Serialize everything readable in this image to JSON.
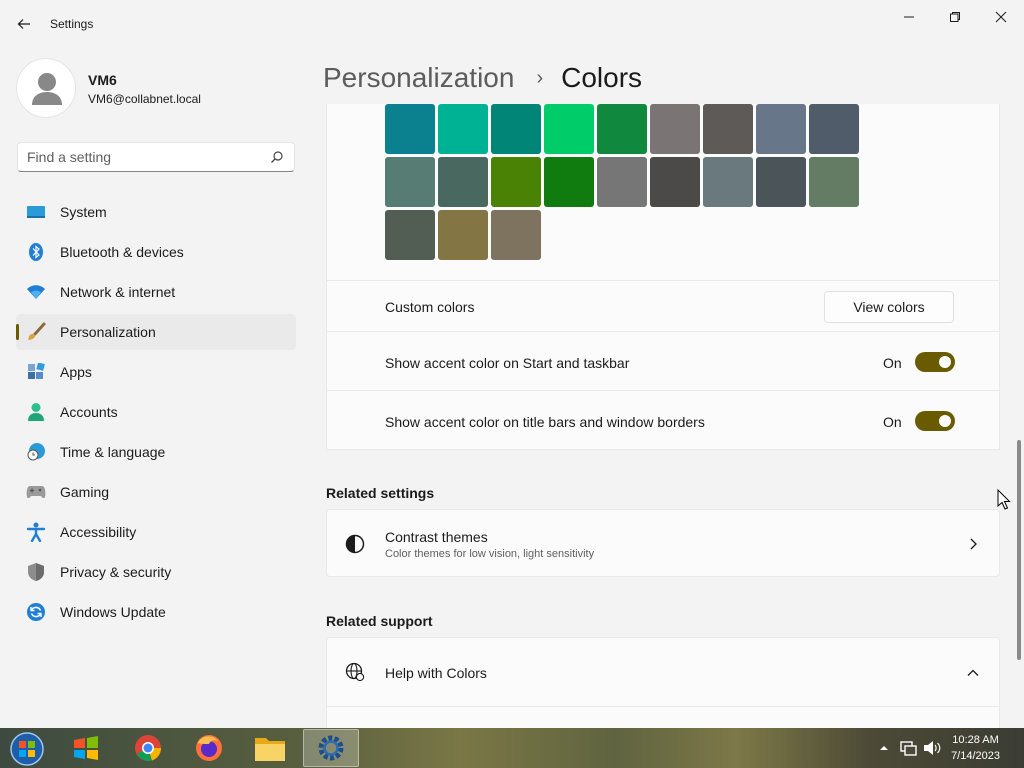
{
  "window": {
    "title": "Settings"
  },
  "profile": {
    "name": "VM6",
    "email": "VM6@collabnet.local"
  },
  "search": {
    "placeholder": "Find a setting"
  },
  "nav": [
    {
      "label": "System",
      "icon": "monitor-icon"
    },
    {
      "label": "Bluetooth & devices",
      "icon": "bluetooth-icon"
    },
    {
      "label": "Network & internet",
      "icon": "wifi-icon"
    },
    {
      "label": "Personalization",
      "icon": "brush-icon",
      "active": true
    },
    {
      "label": "Apps",
      "icon": "apps-icon"
    },
    {
      "label": "Accounts",
      "icon": "person-icon"
    },
    {
      "label": "Time & language",
      "icon": "globe-clock-icon"
    },
    {
      "label": "Gaming",
      "icon": "gamepad-icon"
    },
    {
      "label": "Accessibility",
      "icon": "accessibility-icon"
    },
    {
      "label": "Privacy & security",
      "icon": "shield-icon"
    },
    {
      "label": "Windows Update",
      "icon": "update-icon"
    }
  ],
  "breadcrumb": {
    "parent": "Personalization",
    "separator": "›",
    "current": "Colors"
  },
  "swatches": [
    [
      "#0b8190",
      "#00b294",
      "#008577",
      "#00cc6a",
      "#10893e",
      "#7a7574",
      "#5d5a58",
      "#68768a",
      "#515c6b"
    ],
    [
      "#567c73",
      "#486860",
      "#498205",
      "#107c10",
      "#767676",
      "#4c4a48",
      "#69797e",
      "#4a5459",
      "#647c64"
    ],
    [
      "#525e54",
      "#847545",
      "#7e735f"
    ]
  ],
  "custom_colors": {
    "label": "Custom colors",
    "button": "View colors"
  },
  "accent_start": {
    "label": "Show accent color on Start and taskbar",
    "state": "On"
  },
  "accent_titlebars": {
    "label": "Show accent color on title bars and window borders",
    "state": "On"
  },
  "related_settings": {
    "title": "Related settings",
    "contrast": {
      "title": "Contrast themes",
      "subtitle": "Color themes for low vision, light sensitivity"
    }
  },
  "related_support": {
    "title": "Related support",
    "help": {
      "title": "Help with Colors"
    }
  },
  "taskbar": {
    "apps": [
      "start-orb-icon",
      "windows-logo-icon",
      "chrome-icon",
      "firefox-icon",
      "file-explorer-icon",
      "settings-icon"
    ],
    "time": "10:28 AM",
    "date": "7/14/2023"
  },
  "colors": {
    "accent": "#6b5b00"
  }
}
